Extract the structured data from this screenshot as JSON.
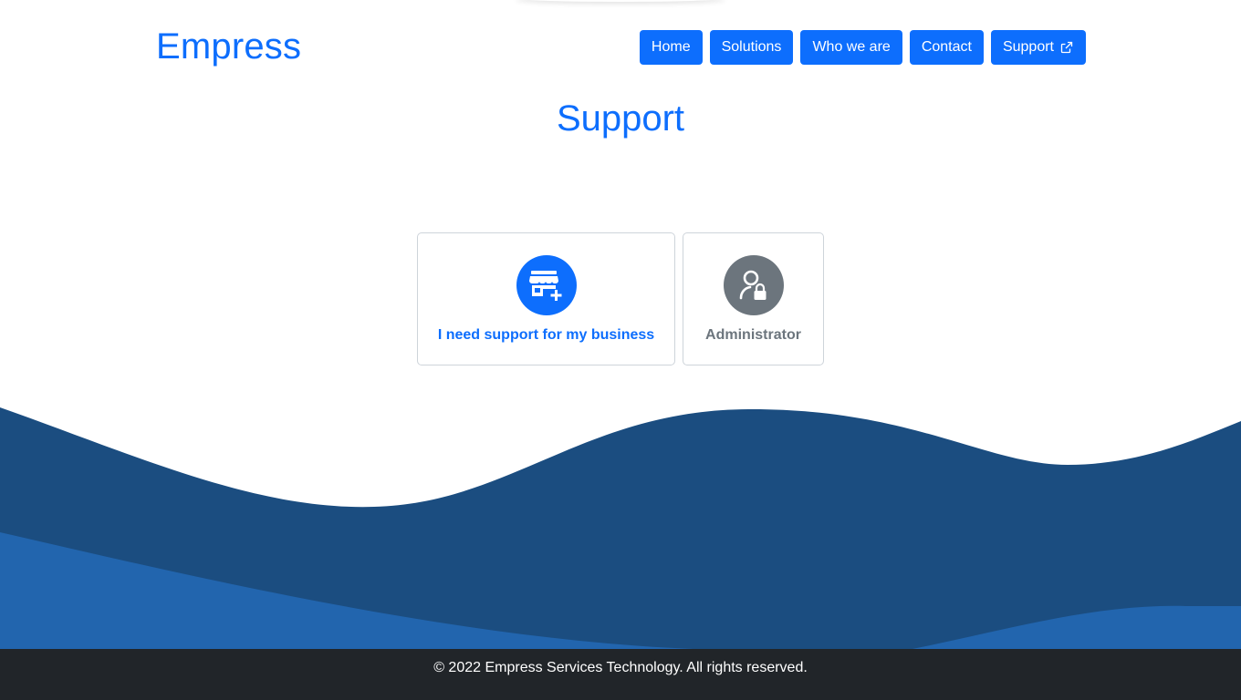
{
  "brand": {
    "name": "Empress"
  },
  "nav": {
    "items": [
      {
        "label": "Home"
      },
      {
        "label": "Solutions"
      },
      {
        "label": "Who we are"
      },
      {
        "label": "Contact"
      },
      {
        "label": "Support",
        "icon": "external-link-icon"
      }
    ]
  },
  "main": {
    "title": "Support",
    "cards": [
      {
        "label": "I need support for my business",
        "icon": "shop-plus-icon",
        "color": "#0d6efd"
      },
      {
        "label": "Administrator",
        "icon": "person-lock-icon",
        "color": "#6c757d"
      }
    ]
  },
  "footer": {
    "text": "© 2022 Empress Services Technology. All rights reserved."
  },
  "colors": {
    "primary": "#0d6efd",
    "secondary": "#6c757d",
    "wave_dark": "#1b4d80",
    "wave_light": "#2265ae",
    "footer_bg": "#212529"
  }
}
